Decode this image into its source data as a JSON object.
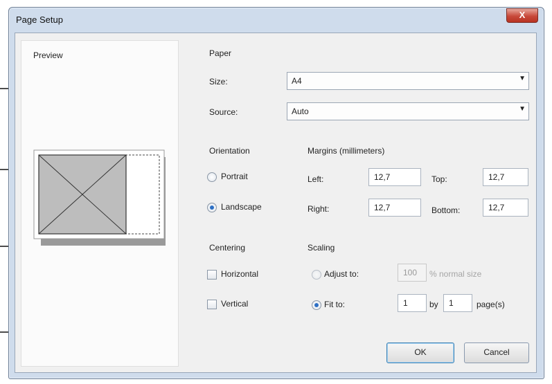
{
  "window": {
    "title": "Page Setup",
    "close_glyph": "X"
  },
  "preview": {
    "label": "Preview"
  },
  "paper": {
    "heading": "Paper",
    "size_label": "Size:",
    "size_value": "A4",
    "source_label": "Source:",
    "source_value": "Auto"
  },
  "orientation": {
    "heading": "Orientation",
    "portrait_label": "Portrait",
    "landscape_label": "Landscape",
    "selected": "Landscape"
  },
  "margins": {
    "heading": "Margins (millimeters)",
    "left_label": "Left:",
    "left_value": "12,7",
    "top_label": "Top:",
    "top_value": "12,7",
    "right_label": "Right:",
    "right_value": "12,7",
    "bottom_label": "Bottom:",
    "bottom_value": "12,7"
  },
  "centering": {
    "heading": "Centering",
    "horizontal_label": "Horizontal",
    "vertical_label": "Vertical"
  },
  "scaling": {
    "heading": "Scaling",
    "adjust_label": "Adjust to:",
    "adjust_value": "100",
    "adjust_suffix": "% normal size",
    "fit_label": "Fit to:",
    "fit_wide_value": "1",
    "by_label": "by",
    "fit_tall_value": "1",
    "pages_suffix": "page(s)",
    "selected": "Fit to"
  },
  "buttons": {
    "ok": "OK",
    "cancel": "Cancel"
  },
  "colors": {
    "accent": "#2d6fc4",
    "title_bar": "#cfdcec",
    "close_button": "#c8493a"
  }
}
